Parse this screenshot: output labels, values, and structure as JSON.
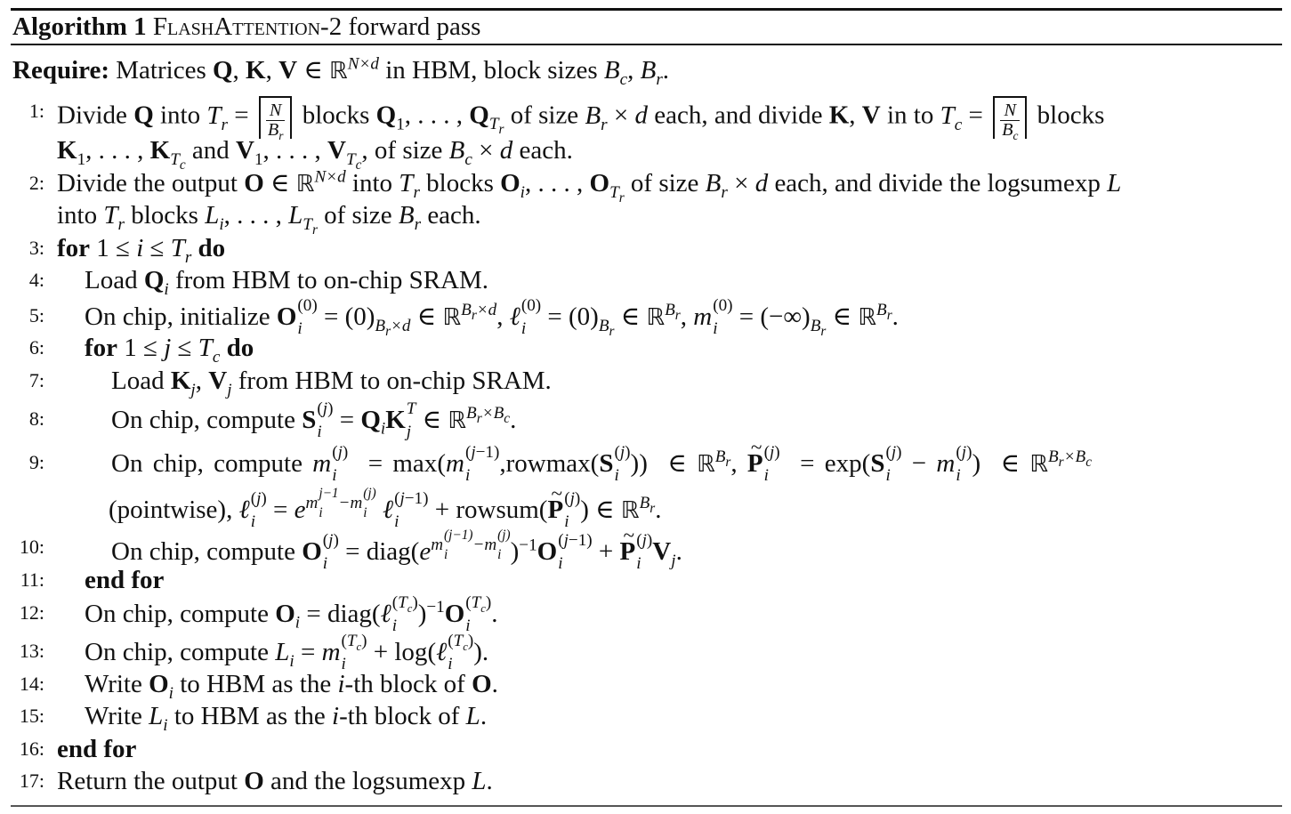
{
  "caption": {
    "label": "Algorithm 1",
    "title_sc": "FlashAttention",
    "title_rest": "-2 forward pass"
  },
  "require": {
    "keyword": "Require:",
    "text": "Matrices Q, K, V ∈ ℝ^{N×d} in HBM, block sizes B_c, B_r."
  },
  "lines": [
    {
      "num": "1:",
      "indent": 0,
      "text": "Divide Q into T_r = ⌈N/B_r⌉ blocks Q_1, …, Q_{T_r} of size B_r × d each, and divide K, V in to T_c = ⌈N/B_c⌉ blocks K_1, …, K_{T_c} and V_1, …, V_{T_c}, of size B_c × d each."
    },
    {
      "num": "2:",
      "indent": 0,
      "text": "Divide the output O ∈ ℝ^{N×d} into T_r blocks O_i, …, O_{T_r} of size B_r × d each, and divide the logsumexp L into T_r blocks L_i, …, L_{T_r} of size B_r each."
    },
    {
      "num": "3:",
      "indent": 0,
      "text": "for 1 ≤ i ≤ T_r do"
    },
    {
      "num": "4:",
      "indent": 1,
      "text": "Load Q_i from HBM to on-chip SRAM."
    },
    {
      "num": "5:",
      "indent": 1,
      "text": "On chip, initialize O_i^{(0)} = (0)_{B_r×d} ∈ ℝ^{B_r×d}, ℓ_i^{(0)} = (0)_{B_r} ∈ ℝ^{B_r}, m_i^{(0)} = (−∞)_{B_r} ∈ ℝ^{B_r}."
    },
    {
      "num": "6:",
      "indent": 1,
      "text": "for 1 ≤ j ≤ T_c do"
    },
    {
      "num": "7:",
      "indent": 2,
      "text": "Load K_j, V_j from HBM to on-chip SRAM."
    },
    {
      "num": "8:",
      "indent": 2,
      "text": "On chip, compute S_i^{(j)} = Q_i K_j^T ∈ ℝ^{B_r×B_c}."
    },
    {
      "num": "9:",
      "indent": 2,
      "text": "On chip, compute m_i^{(j)} = max(m_i^{(j−1)}, rowmax(S_i^{(j)})) ∈ ℝ^{B_r}, P̃_i^{(j)} = exp(S_i^{(j)} − m_i^{(j)}) ∈ ℝ^{B_r×B_c} (pointwise), ℓ_i^{(j)} = e^{m_i^{j−1} − m_i^{(j)}} ℓ_i^{(j−1)} + rowsum(P̃_i^{(j)}) ∈ ℝ^{B_r}."
    },
    {
      "num": "10:",
      "indent": 2,
      "text": "On chip, compute O_i^{(j)} = diag(e^{m_i^{(j−1)} − m_i^{(j)}})^{−1} O_i^{(j−1)} + P̃_i^{(j)} V_j."
    },
    {
      "num": "11:",
      "indent": 1,
      "text": "end for"
    },
    {
      "num": "12:",
      "indent": 1,
      "text": "On chip, compute O_i = diag(ℓ_i^{(T_c)})^{−1} O_i^{(T_c)}."
    },
    {
      "num": "13:",
      "indent": 1,
      "text": "On chip, compute L_i = m_i^{(T_c)} + log(ℓ_i^{(T_c)})."
    },
    {
      "num": "14:",
      "indent": 1,
      "text": "Write O_i to HBM as the i-th block of O."
    },
    {
      "num": "15:",
      "indent": 1,
      "text": "Write L_i to HBM as the i-th block of L."
    },
    {
      "num": "16:",
      "indent": 0,
      "text": "end for"
    },
    {
      "num": "17:",
      "indent": 0,
      "text": "Return the output O and the logsumexp L."
    }
  ],
  "words": {
    "matrices": "Matrices",
    "in_hbm_block_sizes": "in HBM, block sizes",
    "divide": "Divide",
    "into": "into",
    "blocks": "blocks",
    "of_size": "of size",
    "each_and_divide": "each, and divide",
    "in_to": "in to",
    "and": "and",
    "each": "each.",
    "divide_the_output": "Divide the output",
    "each_and_divide_lse": "each, and divide the logsumexp",
    "for": "for",
    "do": "do",
    "load": "Load",
    "from_hbm": "from HBM to on-chip SRAM.",
    "on_chip_init": "On chip, initialize",
    "on_chip_compute": "On chip, compute",
    "pointwise": "(pointwise),",
    "end_for": "end for",
    "write": "Write",
    "to_hbm_as": "to HBM as the",
    "th_block_of": "-th block of",
    "return_output": "Return the output",
    "and_the_logsumexp": "and the logsumexp",
    "max": "max",
    "rowmax": "rowmax",
    "exp": "exp",
    "rowsum": "rowsum",
    "diag": "diag",
    "log": "log"
  }
}
